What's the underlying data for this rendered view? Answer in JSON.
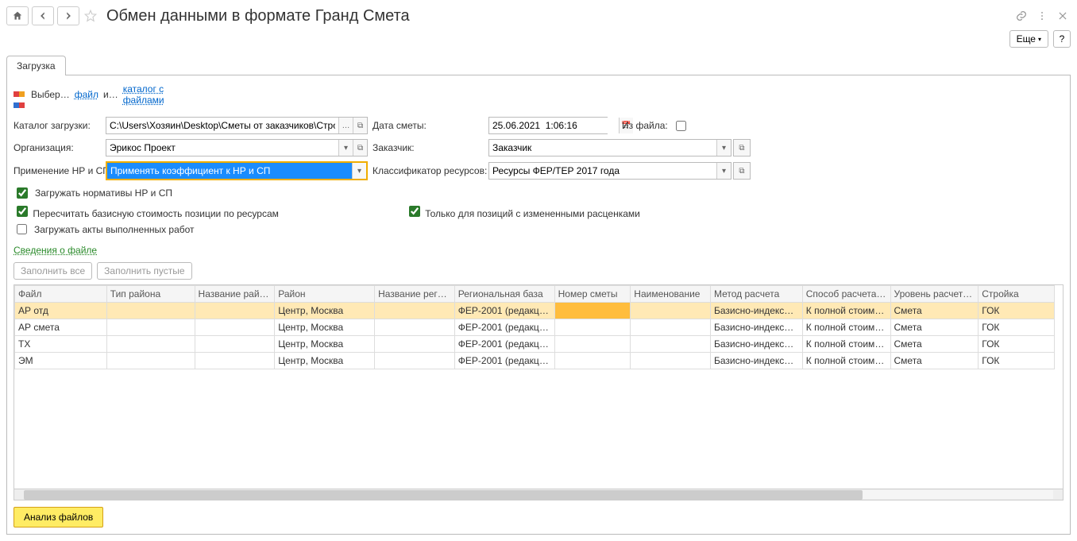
{
  "title": "Обмен данными в формате Гранд Смета",
  "toolbar": {
    "more": "Еще"
  },
  "tab": {
    "load": "Загрузка"
  },
  "file_line": {
    "select_prefix": "Выбер…",
    "file_link": "файл",
    "or": "и…",
    "folder_link": "каталог с файлами"
  },
  "labels": {
    "load_dir": "Каталог загрузки:",
    "org": "Организация:",
    "nr_sp": "Применение НР и СП:",
    "date": "Дата сметы:",
    "from_file": "Из файла:",
    "customer": "Заказчик:",
    "classifier": "Классификатор ресурсов:"
  },
  "values": {
    "load_dir": "C:\\Users\\Хозяин\\Desktop\\Сметы от заказчиков\\Стройсер…",
    "org": "Эрикос Проект",
    "nr_sp": "Применять коэффициент к НР и СП",
    "date": "25.06.2021  1:06:16",
    "customer": "Заказчик",
    "classifier": "Ресурсы ФЕР/ТЕР 2017 года"
  },
  "checks": {
    "load_norms": "Загружать нормативы НР и СП",
    "recalc": "Пересчитать базисную стоимость позиции по ресурсам",
    "only_changed": "Только для позиций с измененными расценками",
    "load_acts": "Загружать акты выполненных работ"
  },
  "info_link": "Сведения о файле",
  "actions": {
    "fill_all": "Заполнить все",
    "fill_empty": "Заполнить пустые",
    "analyze": "Анализ файлов"
  },
  "table": {
    "cols": [
      "Файл",
      "Тип района",
      "Название района",
      "Район",
      "Название региона",
      "Региональная база",
      "Номер сметы",
      "Наименование",
      "Метод расчета",
      "Способ расчета и…",
      "Уровень расчета …",
      "Стройка"
    ],
    "rows": [
      {
        "file": "АР отд",
        "region": "Центр, Москва",
        "base": "ФЕР-2001 (редакция …",
        "method": "Базисно-индексный",
        "calc": "К полной стоимости",
        "level": "Смета",
        "build": "ГОК"
      },
      {
        "file": "АР смета",
        "region": "Центр, Москва",
        "base": "ФЕР-2001 (редакция …",
        "method": "Базисно-индексный",
        "calc": "К полной стоимости",
        "level": "Смета",
        "build": "ГОК"
      },
      {
        "file": "ТХ",
        "region": "Центр, Москва",
        "base": "ФЕР-2001 (редакция …",
        "method": "Базисно-индексный",
        "calc": "К полной стоимости",
        "level": "Смета",
        "build": "ГОК"
      },
      {
        "file": "ЭМ",
        "region": "Центр, Москва",
        "base": "ФЕР-2001 (редакция …",
        "method": "Базисно-индексный",
        "calc": "К полной стоимости",
        "level": "Смета",
        "build": "ГОК"
      }
    ]
  }
}
